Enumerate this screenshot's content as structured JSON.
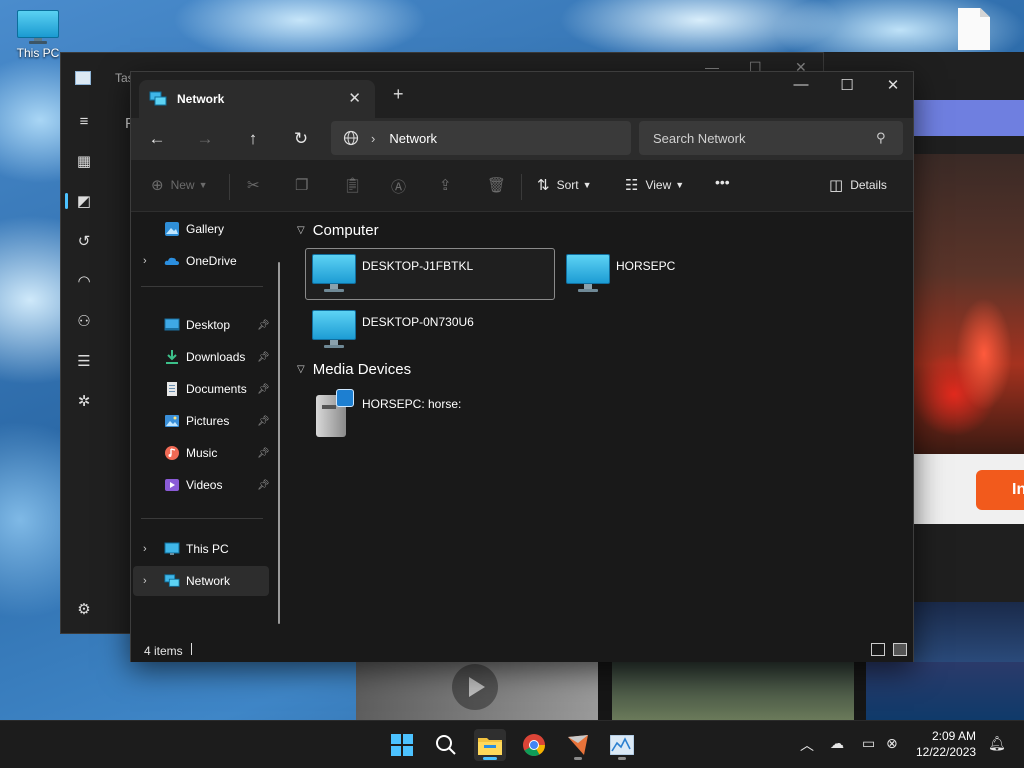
{
  "desktop": {
    "icons": [
      {
        "label": "This PC",
        "icon": "monitor-icon"
      },
      {
        "label": "",
        "icon": "file-icon"
      }
    ]
  },
  "task_manager": {
    "title": "Tas",
    "section_initial": "F",
    "side_icons": [
      "hamburger-icon",
      "processes-icon",
      "performance-icon",
      "app-history-icon",
      "startup-apps-icon",
      "users-icon",
      "details-icon",
      "services-icon",
      "settings-icon"
    ]
  },
  "background_app": {
    "button_label": "In"
  },
  "explorer": {
    "tab": {
      "label": "Network",
      "icon": "network-icon"
    },
    "window_controls": {
      "minimize": "—",
      "maximize": "☐",
      "close": "✕"
    },
    "nav": {
      "back": "←",
      "forward": "→",
      "up": "↑",
      "refresh": "↻"
    },
    "address": {
      "root_icon": "globe-icon",
      "path": "Network"
    },
    "search": {
      "placeholder": "Search Network"
    },
    "commands": {
      "new": "New",
      "sort": "Sort",
      "view": "View",
      "more": "•••",
      "details": "Details"
    },
    "nav_pane": {
      "items": [
        {
          "label": "Gallery",
          "icon": "gallery-icon",
          "expandable": false,
          "pinned": false
        },
        {
          "label": "OneDrive",
          "icon": "onedrive-icon",
          "expandable": true,
          "pinned": false
        },
        {
          "label": "Desktop",
          "icon": "desktop-folder-icon",
          "expandable": false,
          "pinned": true
        },
        {
          "label": "Downloads",
          "icon": "downloads-icon",
          "expandable": false,
          "pinned": true
        },
        {
          "label": "Documents",
          "icon": "documents-icon",
          "expandable": false,
          "pinned": true
        },
        {
          "label": "Pictures",
          "icon": "pictures-icon",
          "expandable": false,
          "pinned": true
        },
        {
          "label": "Music",
          "icon": "music-icon",
          "expandable": false,
          "pinned": true
        },
        {
          "label": "Videos",
          "icon": "videos-icon",
          "expandable": false,
          "pinned": true
        },
        {
          "label": "This PC",
          "icon": "this-pc-icon",
          "expandable": true,
          "pinned": false
        },
        {
          "label": "Network",
          "icon": "network-icon",
          "expandable": true,
          "pinned": false,
          "selected": true
        }
      ]
    },
    "groups": {
      "computer": {
        "title": "Computer",
        "items": [
          "DESKTOP-J1FBTKL",
          "HORSEPC",
          "DESKTOP-0N730U6"
        ]
      },
      "media": {
        "title": "Media Devices",
        "items": [
          "HORSEPC: horse:"
        ]
      }
    },
    "status": {
      "count": "4 items"
    }
  },
  "taskbar": {
    "apps": [
      "start-icon",
      "search-icon",
      "file-explorer-icon",
      "chrome-icon",
      "app-icon",
      "task-manager-icon"
    ],
    "tray": [
      "chevron-up-icon",
      "onedrive-tray-icon",
      "display-icon",
      "network-volume-icon"
    ],
    "time": "2:09 AM",
    "date": "12/22/2023"
  },
  "colors": {
    "accent": "#4cc2ff",
    "window_bg": "#191919",
    "toolbar_bg": "#202020"
  }
}
